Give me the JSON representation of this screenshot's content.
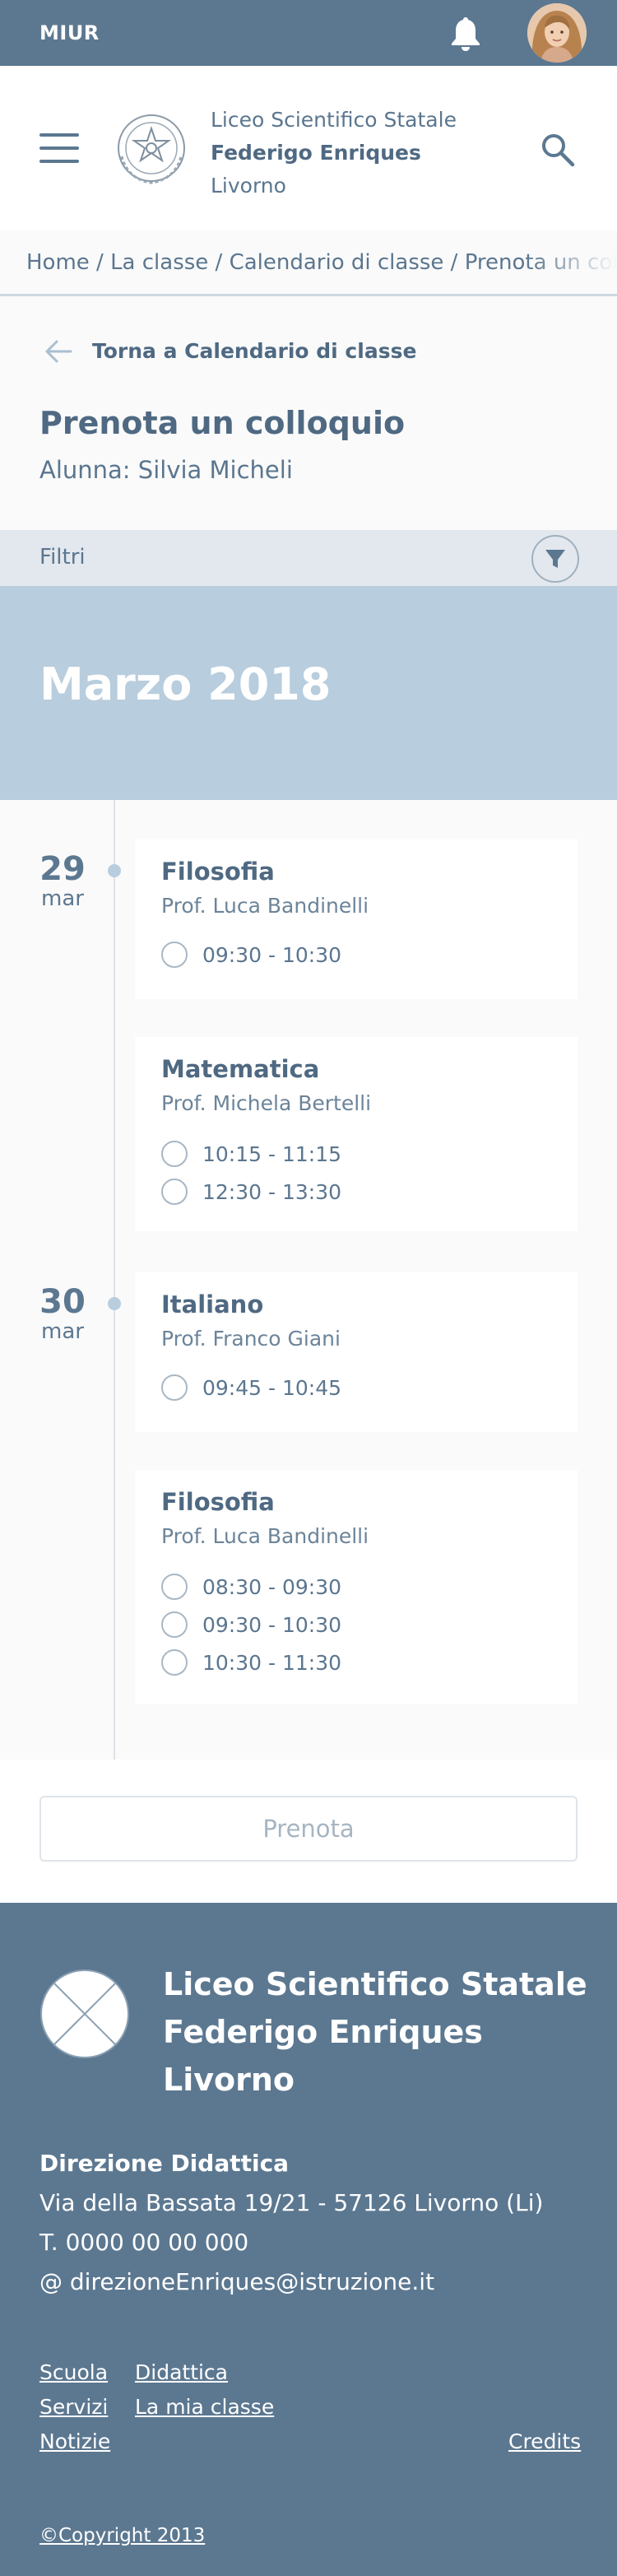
{
  "topbar": {
    "brand": "MIUR",
    "notification_icon": "bell-icon",
    "avatar": "user-avatar"
  },
  "header": {
    "school_type": "Liceo Scientifico Statale",
    "school_name": "Federigo Enriques",
    "city": "Livorno",
    "menu_icon": "hamburger-icon",
    "search_icon": "search-icon"
  },
  "breadcrumb": {
    "text": "Home / La classe / Calendario di classe / Prenota un colloquio"
  },
  "back": {
    "label": "Torna a Calendario di classe"
  },
  "page": {
    "title": "Prenota un colloquio",
    "student": "Alunna: Silvia Micheli"
  },
  "filters": {
    "label": "Filtri",
    "icon": "filter-icon"
  },
  "month": {
    "label": "Marzo 2018"
  },
  "days": [
    {
      "day": "29",
      "month": "mar",
      "appointments": [
        {
          "subject": "Filosofia",
          "teacher": "Prof. Luca Bandinelli",
          "slots": [
            "09:30 - 10:30"
          ]
        },
        {
          "subject": "Matematica",
          "teacher": "Prof. Michela Bertelli",
          "slots": [
            "10:15 - 11:15",
            "12:30 - 13:30"
          ]
        }
      ]
    },
    {
      "day": "30",
      "month": "mar",
      "appointments": [
        {
          "subject": "Italiano",
          "teacher": "Prof. Franco Giani",
          "slots": [
            "09:45 - 10:45"
          ]
        },
        {
          "subject": "Filosofia",
          "teacher": "Prof. Luca Bandinelli",
          "slots": [
            "08:30 - 09:30",
            "09:30 - 10:30",
            "10:30 - 11:30"
          ]
        }
      ]
    }
  ],
  "actions": {
    "submit_label": "Prenota"
  },
  "footer": {
    "school_line1": "Liceo Scientifico Statale",
    "school_line2": "Federigo Enriques",
    "school_line3": "Livorno",
    "office": "Direzione Didattica",
    "address": "Via della Bassata 19/21 - 57126 Livorno (Li)",
    "phone": "T. 0000 00 00 000",
    "email": "@ direzioneEnriques@istruzione.it",
    "links": {
      "scuola": "Scuola",
      "didattica": "Didattica",
      "servizi": "Servizi",
      "la_mia_classe": "La mia classe",
      "notizie": "Notizie",
      "credits": "Credits"
    },
    "copyright": "©Copyright 2013"
  },
  "colors": {
    "primary": "#5c7891",
    "month_band": "#b8cddd",
    "filters_bar": "#e3e8ee",
    "background": "#fafafa"
  }
}
